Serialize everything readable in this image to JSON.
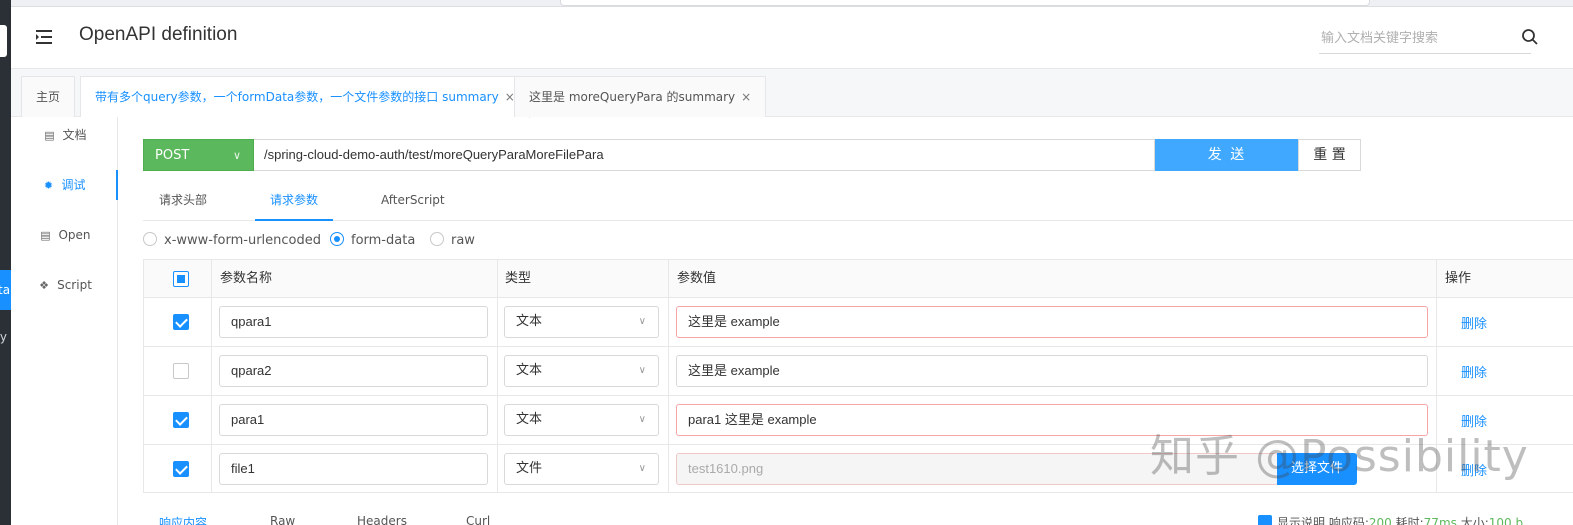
{
  "app": {
    "title": "OpenAPI definition"
  },
  "search": {
    "placeholder": "输入文档关键字搜索"
  },
  "tabs": [
    {
      "label": "主页"
    },
    {
      "label": "带有多个query参数，一个formData参数，一个文件参数的接口 summary",
      "close": "×"
    },
    {
      "label": "这里是 moreQueryPara 的summary",
      "close": "×"
    }
  ],
  "sidebar": {
    "items": [
      {
        "label": "文档",
        "icon": "document-icon"
      },
      {
        "label": "调试",
        "icon": "bug-icon"
      },
      {
        "label": "Open",
        "icon": "file-icon"
      },
      {
        "label": "Script",
        "icon": "code-icon"
      }
    ]
  },
  "outer_left": {
    "chip1": "ta",
    "chip2": "ry"
  },
  "request": {
    "method": "POST",
    "url": "/spring-cloud-demo-auth/test/moreQueryParaMoreFilePara",
    "send_label": "发 送",
    "reset_label": "重 置"
  },
  "subtabs": [
    {
      "label": "请求头部"
    },
    {
      "label": "请求参数"
    },
    {
      "label": "AfterScript"
    }
  ],
  "body_types": [
    {
      "label": "x-www-form-urlencoded",
      "checked": false
    },
    {
      "label": "form-data",
      "checked": true
    },
    {
      "label": "raw",
      "checked": false
    }
  ],
  "table": {
    "headers": {
      "name": "参数名称",
      "type": "类型",
      "value": "参数值",
      "action": "操作"
    },
    "rows": [
      {
        "checked": true,
        "name": "qpara1",
        "type": "文本",
        "value": "这里是 example",
        "action": "删除"
      },
      {
        "checked": false,
        "name": "qpara2",
        "type": "文本",
        "value": "这里是 example",
        "action": "删除"
      },
      {
        "checked": true,
        "name": "para1",
        "type": "文本",
        "value": "para1 这里是 example",
        "action": "删除"
      },
      {
        "checked": true,
        "name": "file1",
        "type": "文件",
        "value": "test1610.png",
        "action": "删除",
        "file_button": "选择文件"
      }
    ]
  },
  "response": {
    "tabs": [
      "响应内容",
      "Raw",
      "Headers",
      "Curl"
    ],
    "show_desc": "显示说明",
    "code_label": "响应码:",
    "code": "200",
    "time_label": "耗时:",
    "time": "77ms",
    "size_label": "大小:",
    "size": "100 b"
  },
  "watermark": "知乎 @Possibility",
  "colors": {
    "primary": "#1890ff",
    "method_post": "#5cb85c",
    "send": "#40a9ff"
  }
}
